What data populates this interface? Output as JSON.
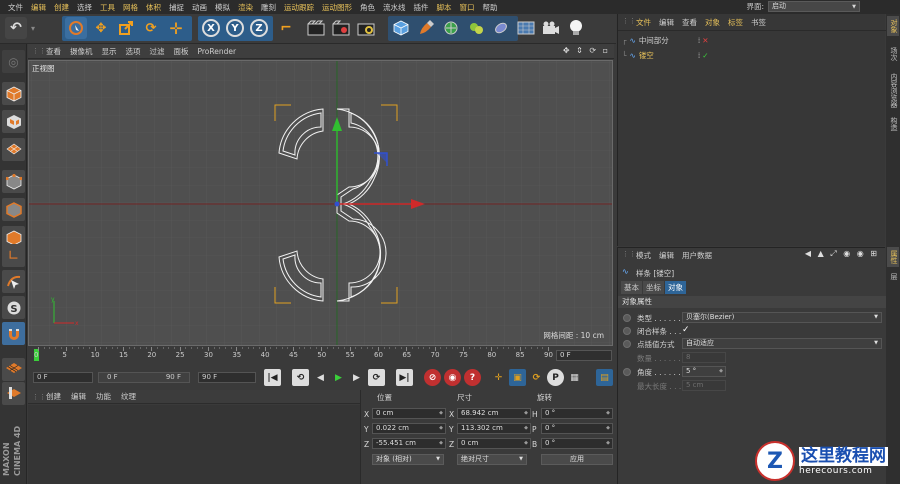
{
  "menubar": {
    "items": [
      "文件",
      "编辑",
      "创建",
      "选择",
      "工具",
      "网格",
      "体积",
      "捕捉",
      "动画",
      "模拟",
      "渲染",
      "雕刻",
      "运动跟踪",
      "运动图形",
      "角色",
      "流水线",
      "插件",
      "脚本",
      "窗口",
      "帮助"
    ],
    "layout_label": "界面:",
    "layout_value": "启动"
  },
  "toolbar": {
    "icons": [
      "undo-icon",
      "live-select-icon",
      "move-icon",
      "scale-icon",
      "rotate-icon",
      "recent-tools-icon",
      "x-axis-icon",
      "y-axis-icon",
      "z-axis-icon",
      "coordinate-system-icon",
      "render-view-icon",
      "render-picture-queue-icon",
      "edit-render-settings-icon",
      "cube-icon",
      "pen-icon",
      "subdivision-icon",
      "array-icon",
      "deformer-icon",
      "floor-icon",
      "camera-icon",
      "light-icon"
    ],
    "axis_labels": [
      "X",
      "Y",
      "Z"
    ]
  },
  "viewport": {
    "menu": [
      "查看",
      "摄像机",
      "显示",
      "选项",
      "过滤",
      "面板",
      "ProRender"
    ],
    "view_label": "正视图",
    "grid_info": "网格间距 : 10 cm"
  },
  "timeline": {
    "ticks": [
      "0",
      "5",
      "10",
      "15",
      "20",
      "25",
      "30",
      "35",
      "40",
      "45",
      "50",
      "55",
      "60",
      "65",
      "70",
      "75",
      "80",
      "85",
      "90"
    ],
    "current_frame": "0 F"
  },
  "transport": {
    "start_frame": "0 F",
    "range_start": "0 F",
    "range_end": "90 F",
    "end_frame": "90 F"
  },
  "material": {
    "menu": [
      "创建",
      "编辑",
      "功能",
      "纹理"
    ]
  },
  "coords": {
    "headers": [
      "位置",
      "尺寸",
      "旋转"
    ],
    "axes": [
      "X",
      "Y",
      "Z"
    ],
    "rot_axes": [
      "H",
      "P",
      "B"
    ],
    "position": [
      "0 cm",
      "0.022 cm",
      "-55.451 cm"
    ],
    "size": [
      "68.942 cm",
      "113.302 cm",
      "0 cm"
    ],
    "rotation": [
      "0 °",
      "0 °",
      "0 °"
    ],
    "mode_select": "对象 (相对)",
    "size_select": "绝对尺寸",
    "apply_button": "应用"
  },
  "object_manager": {
    "menu": [
      "文件",
      "编辑",
      "查看",
      "对象",
      "标签",
      "书签"
    ],
    "objects": [
      {
        "name": "中间部分",
        "active": false
      },
      {
        "name": "镂空",
        "active": true
      }
    ]
  },
  "side_tabs_top": [
    "对象",
    "场次",
    "内容浏览器",
    "构造"
  ],
  "side_tabs_bottom": [
    "属性",
    "层"
  ],
  "attributes": {
    "menu": [
      "模式",
      "编辑",
      "用户数据"
    ],
    "title": "样条 [镂空]",
    "tabs": [
      "基本",
      "坐标",
      "对象"
    ],
    "section": "对象属性",
    "rows": [
      {
        "label": "类型 . . . . . . . .",
        "value": "贝塞尔(Bezier)",
        "dim": false
      },
      {
        "label": "闭合样条 . . .",
        "value": "✓",
        "dim": false
      },
      {
        "label": "点插值方式",
        "value": "自动适应",
        "dim": false
      },
      {
        "label": "数量 . . . . . . . .",
        "value": "8",
        "dim": true
      },
      {
        "label": "角度 . . . . . . . .",
        "value": "5 °",
        "dim": false
      },
      {
        "label": "最大长度 . . . .",
        "value": "5 cm",
        "dim": true
      }
    ]
  },
  "watermark": {
    "title": "这里教程网",
    "url": "herecours.com"
  },
  "maxon": "MAXON CINEMA 4D",
  "colors": {
    "accent": "#e8c25a",
    "axis_x": "#d22a2a",
    "axis_y": "#2fb02f",
    "selection": "#2e6598"
  }
}
